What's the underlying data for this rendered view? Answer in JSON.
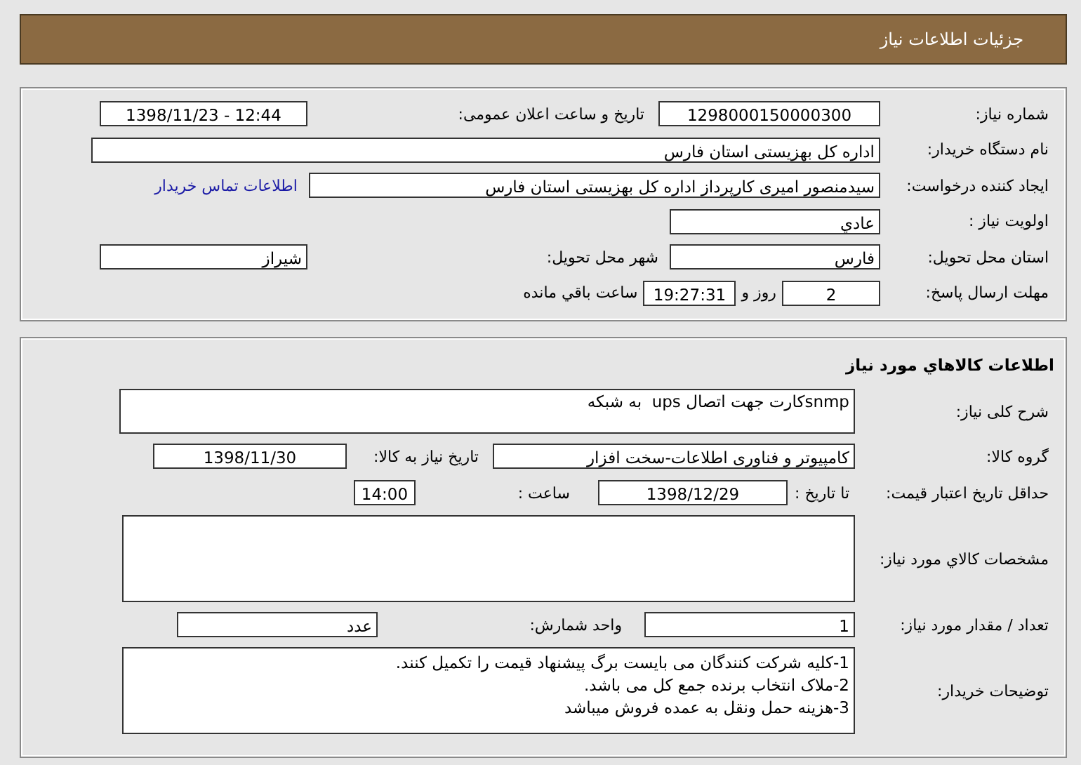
{
  "header": {
    "title": "جزئیات اطلاعات نیاز"
  },
  "summary": {
    "need_number": {
      "label": "شماره نیاز:",
      "value": "1298000150000300"
    },
    "announce_datetime": {
      "label": "تاریخ و ساعت اعلان عمومی:",
      "value": "1398/11/23 - 12:44"
    },
    "buyer_org": {
      "label": "نام دستگاه خریدار:",
      "value": "اداره کل بهزیستی استان فارس"
    },
    "requester": {
      "label": "ایجاد کننده درخواست:",
      "value": "سیدمنصور امیری کارپرداز اداره کل بهزیستی استان فارس",
      "link": "اطلاعات تماس خریدار"
    },
    "priority": {
      "label": "اولویت نیاز :",
      "value": "عادي"
    },
    "province": {
      "label": "استان محل تحویل:",
      "value": "فارس"
    },
    "city": {
      "label": "شهر محل تحویل:",
      "value": "شیراز"
    },
    "deadline": {
      "label": "مهلت ارسال پاسخ:",
      "days": "2",
      "days_unit": "روز و",
      "time": "19:27:31",
      "remaining": "ساعت باقي مانده"
    }
  },
  "goods": {
    "title": "اطلاعات کالاهاي مورد نياز",
    "description": {
      "label": "شرح کلی نیاز:",
      "value": "snmpکارت جهت اتصال ups  به شبکه"
    },
    "group": {
      "label": "گروه کالا:",
      "value": "کامپیوتر و فناوری اطلاعات-سخت افزار"
    },
    "need_date": {
      "label": "تاریخ نیاز به کالا:",
      "value": "1398/11/30"
    },
    "price_validity": {
      "label": "حداقل تاریخ اعتبار قیمت:",
      "to_label": "تا تاریخ :",
      "date": "1398/12/29",
      "time_label": "ساعت :",
      "time": "14:00"
    },
    "specs": {
      "label": "مشخصات کالاي مورد نياز:"
    },
    "quantity": {
      "label": "تعداد / مقدار مورد نیاز:",
      "value": "1"
    },
    "unit": {
      "label": "واحد شمارش:",
      "value": "عدد"
    },
    "notes": {
      "label": "توضیحات خریدار:",
      "lines": [
        "1-کلیه شرکت کنندگان می بایست برگ پیشنهاد قیمت را تکمیل کنند.",
        "2-ملاک انتخاب برنده جمع کل می باشد.",
        "3-هزینه حمل ونقل به عمده فروش میباشد"
      ]
    }
  }
}
